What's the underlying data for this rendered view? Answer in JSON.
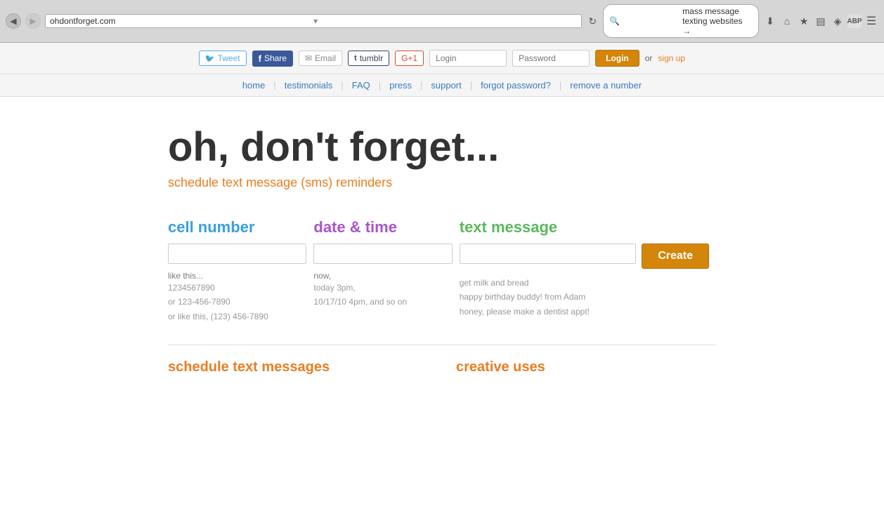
{
  "browser": {
    "back_icon": "◀",
    "forward_icon": "▶",
    "reload_icon": "↻",
    "url": "ohdontforget.com",
    "url_dropdown": "▾",
    "search_query": "mass message texting websites →",
    "download_icon": "⬇",
    "home_icon": "⌂",
    "bookmark_icon": "★",
    "reader_icon": "≡",
    "pocket_icon": "◈",
    "adblock_icon": "ABP",
    "menu_icon": "☰"
  },
  "social": {
    "tweet_label": "Tweet",
    "share_label": "Share",
    "email_label": "Email",
    "tumblr_label": "tumblr",
    "gplus_label": "G+1"
  },
  "auth": {
    "login_placeholder": "Login",
    "password_placeholder": "Password",
    "login_btn": "Login",
    "or_text": "or",
    "signup_link": "sign up"
  },
  "nav": {
    "items": [
      "home",
      "testimonials",
      "FAQ",
      "press",
      "support",
      "forgot password?",
      "remove a number"
    ]
  },
  "main": {
    "title": "oh, don't forget...",
    "subtitle": "schedule text message (sms) reminders",
    "cell_number_label": "cell number",
    "date_time_label": "date & time",
    "text_message_label": "text message",
    "create_btn": "Create",
    "cell_hint_label": "like this...",
    "cell_hints": [
      "1234567890",
      "or 123-456-7890",
      "or like this, (123) 456-7890"
    ],
    "date_hint_label": "now,",
    "date_hints": [
      "today 3pm,",
      "10/17/10 4pm, and so on"
    ],
    "text_hint_label": "",
    "text_hints": [
      "get milk and bread",
      "happy birthday buddy! from Adam",
      "honey, please make a dentist appt!"
    ]
  },
  "footer": {
    "schedule_title": "schedule text messages",
    "creative_title": "creative uses"
  }
}
